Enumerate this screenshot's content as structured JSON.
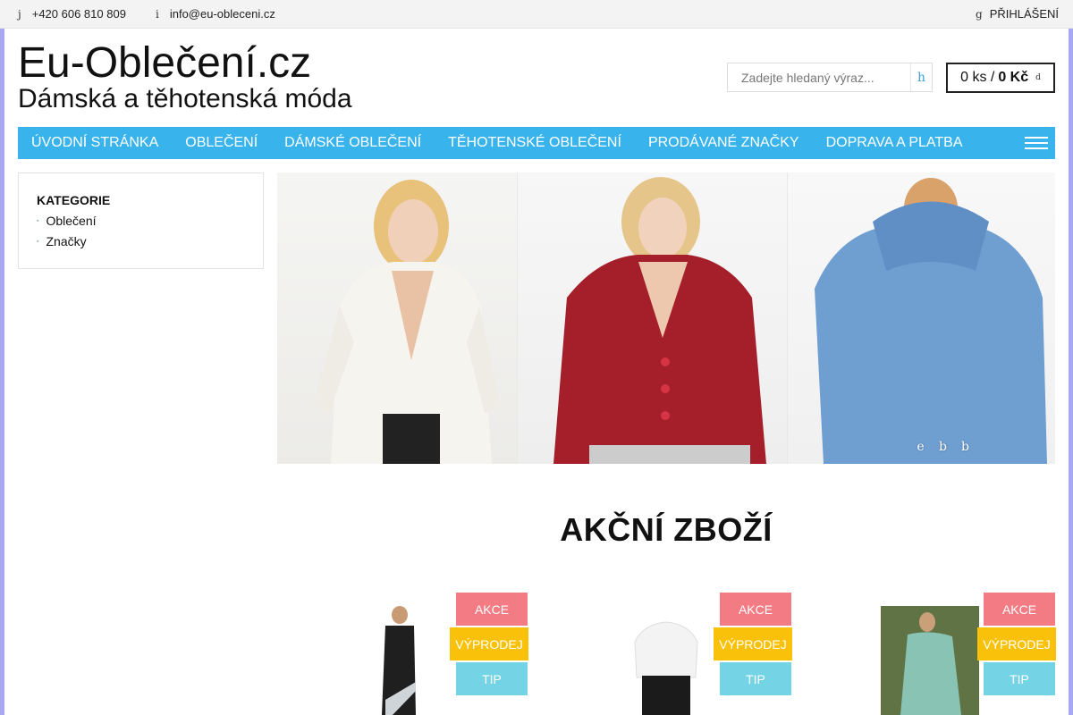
{
  "topbar": {
    "phone_icon": "j",
    "phone": "+420 606 810 809",
    "email_icon": "i",
    "email": "info@eu-obleceni.cz",
    "login_icon": "g",
    "login": "PŘIHLÁŠENÍ"
  },
  "header": {
    "title": "Eu-Oblečení.cz",
    "subtitle": "Dámská a těhotenská móda"
  },
  "search": {
    "placeholder": "Zadejte hledaný výraz...",
    "button_icon": "h"
  },
  "cart": {
    "count": "0 ks /",
    "total": "0 Kč",
    "icon": "d"
  },
  "nav": {
    "items": [
      {
        "label": "ÚVODNÍ STRÁNKA"
      },
      {
        "label": "OBLEČENÍ"
      },
      {
        "label": "DÁMSKÉ OBLEČENÍ"
      },
      {
        "label": "TĚHOTENSKÉ OBLEČENÍ"
      },
      {
        "label": "PRODÁVANÉ ZNAČKY"
      },
      {
        "label": "DOPRAVA A PLATBA"
      }
    ]
  },
  "sidebar": {
    "heading": "KATEGORIE",
    "items": [
      {
        "label": "Oblečení"
      },
      {
        "label": "Značky"
      }
    ]
  },
  "slider": {
    "dots": [
      "e",
      "b",
      "b"
    ],
    "colors": {
      "sweater1": "#f6f4ef",
      "sweater2": "#a51f2b",
      "sweater3": "#6f9ed1"
    }
  },
  "section": {
    "title": "AKČNÍ ZBOŽÍ"
  },
  "products": [
    {
      "badges": {
        "akce": "AKCE",
        "vyprodej": "VÝPRODEJ",
        "tip": "TIP"
      }
    },
    {
      "badges": {
        "akce": "AKCE",
        "vyprodej": "VÝPRODEJ",
        "tip": "TIP"
      }
    },
    {
      "badges": {
        "akce": "AKCE",
        "vyprodej": "VÝPRODEJ",
        "tip": "TIP"
      }
    }
  ],
  "colors": {
    "accent": "#38b3ec",
    "akce": "#f37b83",
    "vyprodej": "#f9c10a",
    "tip": "#74d3e5"
  }
}
